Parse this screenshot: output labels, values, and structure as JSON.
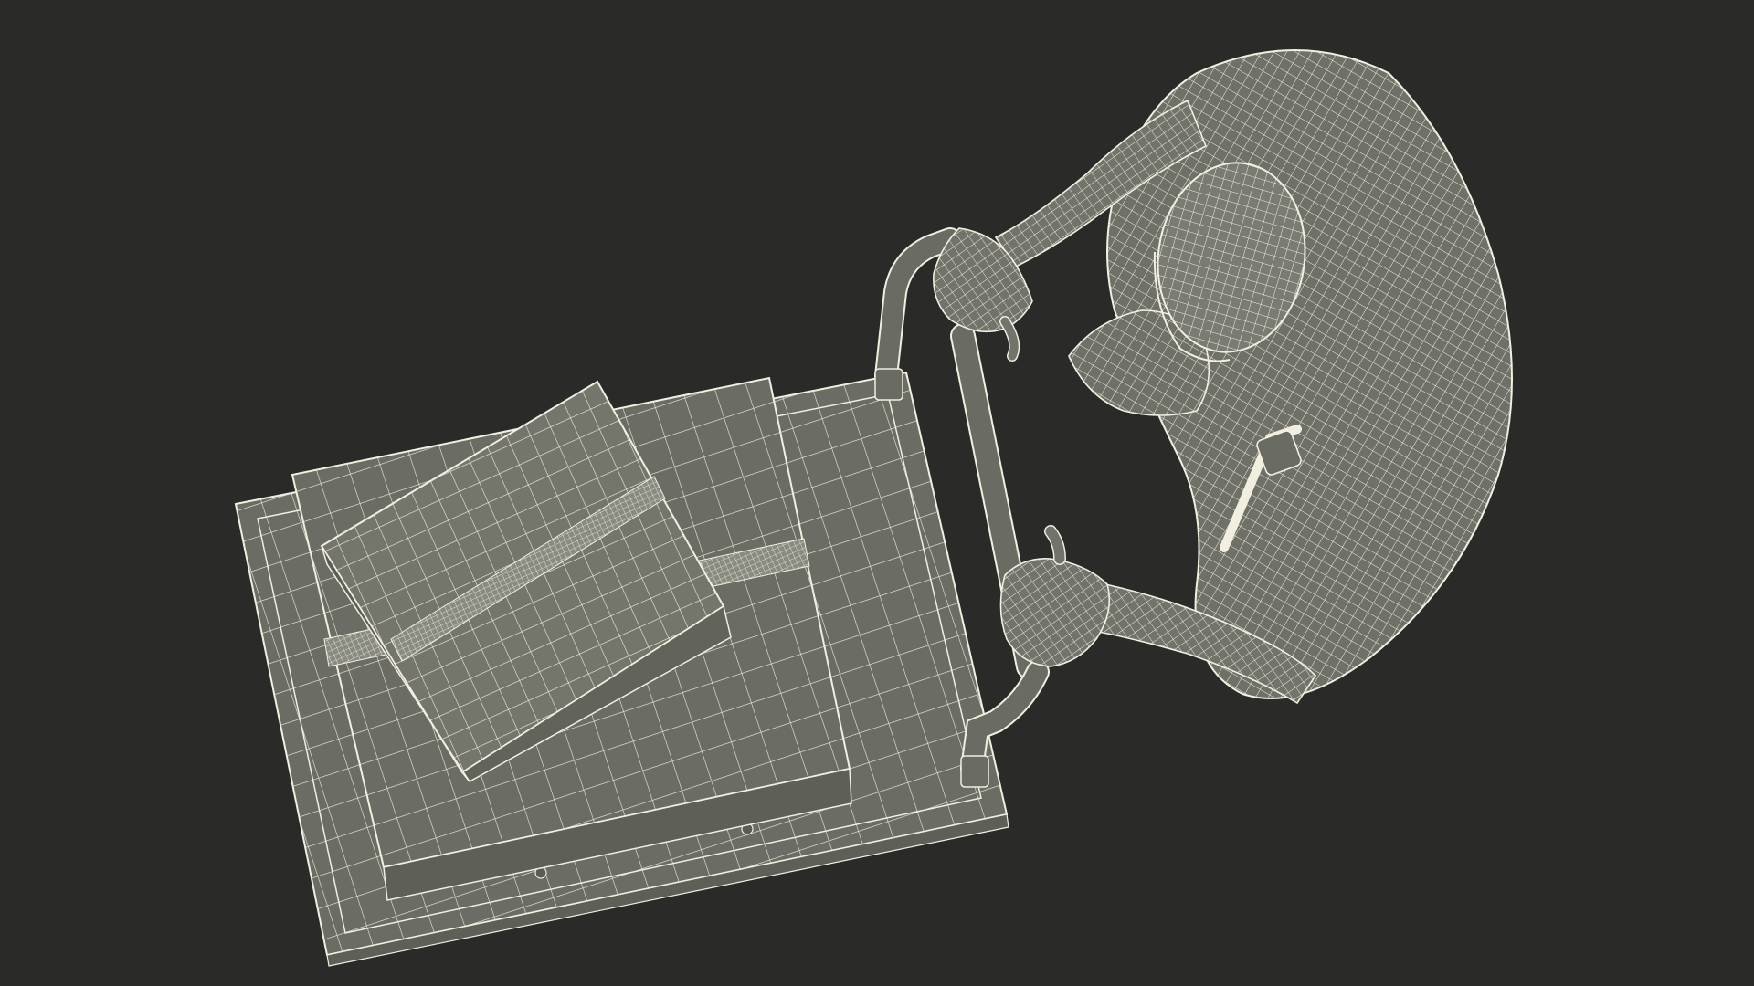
{
  "scene": {
    "background_color": "#2a2a29",
    "mesh_fill_color": "#6e6f66",
    "mesh_fill_light": "#7d7e74",
    "mesh_fill_dark": "#5a5b53",
    "wire_color": "#f2efe0",
    "render_style": "wireframe-over-shaded",
    "subject": [
      "worker-figure",
      "platform-hand-truck",
      "cardboard-box-large",
      "cardboard-box-small"
    ]
  }
}
